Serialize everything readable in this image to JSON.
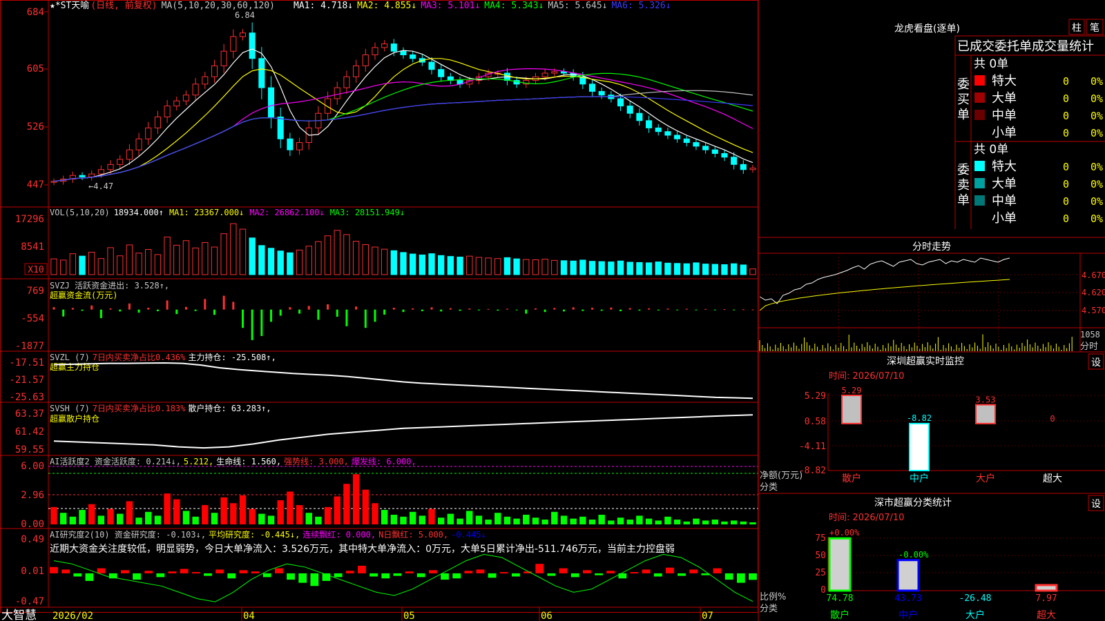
{
  "header": {
    "stock": "★*ST天喻",
    "mode": "(日线, 前复权)",
    "ma_title": "MA(5,10,20,30,60,120)",
    "ma_items": [
      {
        "label": "MA1: 4.718↓",
        "color": "#ffffff"
      },
      {
        "label": "MA2: 4.855↓",
        "color": "#ffff00"
      },
      {
        "label": "MA3: 5.101↓",
        "color": "#ff00ff"
      },
      {
        "label": "MA4: 5.343↓",
        "color": "#00ff00"
      },
      {
        "label": "MA5: 5.645↓",
        "color": "#c0c0c0"
      },
      {
        "label": "MA6: 5.326↓",
        "color": "#3a3aff"
      }
    ],
    "high_label": "6.84",
    "low_label": "←4.47"
  },
  "price_axis": [
    "684",
    "605",
    "526",
    "447"
  ],
  "volume_panel": {
    "title": "VOL(5,10,20)",
    "value": "18934.000↑",
    "ma1": "MA1: 23367.000↓",
    "ma2": "MA2: 26862.100↓",
    "ma3": "MA3: 28151.949↓",
    "axis": [
      "17296",
      "8541"
    ],
    "unit": "X10"
  },
  "svzj_panel": {
    "title": "SVZJ  活跃资金进出: 3.528↑,",
    "subtitle": "超赢资金流(万元)",
    "axis": [
      "769",
      "-554",
      "-1877"
    ]
  },
  "svzl_panel": {
    "title": "SVZL (7)",
    "red_text": "7日内买卖净占比0.436%",
    "hold": "主力持仓: -25.508↑,",
    "subtitle": "超赢主力持仓",
    "axis": [
      "-17.51",
      "-21.57",
      "-25.63"
    ]
  },
  "svsh_panel": {
    "title": "SVSH (7)",
    "red_text": "7日内买卖净占比0.183%",
    "hold": "散户持仓: 63.283↑,",
    "subtitle": "超赢散户持仓",
    "axis": [
      "63.37",
      "61.42",
      "59.55"
    ]
  },
  "ai_activity_panel": {
    "title": "AI活跃度2 资金活跃度: 0.214↓,",
    "v2": "5.212,",
    "life": "生命线: 1.560,",
    "strong": "强势线: 3.000,",
    "burst": "爆发线: 6.000,",
    "axis": [
      "6.00",
      "2.96",
      "0.00"
    ]
  },
  "ai_research_panel": {
    "title": "AI研究度2(10) 资金研究度: -0.103↓,",
    "avg": "平均研究度: -0.445↓,",
    "red_flag": "连续飘红: 0.000,",
    "n_flag": "N日飘红: 5.000,",
    "last": "-0.445↓",
    "comment": "近期大资金关注度较低，明显弱势，今日大单净流入：3.526万元，其中特大单净流入：0万元，大单5日累计净出-511.746万元，当前主力控盘弱",
    "axis": [
      "0.49",
      "0.01",
      "-0.47"
    ]
  },
  "footer": {
    "brand": "大智慧",
    "dates": [
      "2026/02",
      "04",
      "05",
      "06",
      "07"
    ]
  },
  "right_panel": {
    "title": "龙虎看盘(逐单)",
    "btn1": "柱",
    "btn2": "笔",
    "table_header": "已成交委托单成交量统计",
    "buy_label": "委买单",
    "sell_label": "委卖单",
    "buy_total": "共 0单",
    "sell_total": "共 0单",
    "buy_rows": [
      {
        "label": "特大",
        "color": "#ff0000",
        "v": "0",
        "p": "0%"
      },
      {
        "label": "大单",
        "color": "#a00000",
        "v": "0",
        "p": "0%"
      },
      {
        "label": "中单",
        "color": "#6a0000",
        "v": "0",
        "p": "0%"
      },
      {
        "label": "小单",
        "color": "none",
        "v": "0",
        "p": "0%"
      }
    ],
    "sell_rows": [
      {
        "label": "特大",
        "color": "#00ffff",
        "v": "0",
        "p": "0%"
      },
      {
        "label": "大单",
        "color": "#00a0a0",
        "v": "0",
        "p": "0%"
      },
      {
        "label": "中单",
        "color": "#007878",
        "v": "0",
        "p": "0%"
      },
      {
        "label": "小单",
        "color": "none",
        "v": "0",
        "p": "0%"
      }
    ],
    "intraday_title": "分时走势",
    "intraday_axis": [
      "4.670",
      "4.620",
      "4.570"
    ],
    "intraday_vol": "1058",
    "intraday_unit": "分时",
    "monitor_title": "深圳超赢实时监控",
    "monitor_time": "时间: 2026/07/10",
    "monitor_axis": [
      "5.29",
      "0.58",
      "-4.11",
      "-8.82"
    ],
    "monitor_ylabel": "净额(万元)",
    "monitor_xlabel": "分类",
    "monitor_set": "设",
    "monitor_bars": [
      {
        "cat": "散户",
        "value": "5.29"
      },
      {
        "cat": "中户",
        "value": "-8.82"
      },
      {
        "cat": "大户",
        "value": "3.53"
      },
      {
        "cat": "超大",
        "value": "0"
      }
    ],
    "stat_title": "深市超赢分类统计",
    "stat_time": "时间: 2026/07/10",
    "stat_axis": [
      "75",
      "50",
      "25",
      "0"
    ],
    "stat_ylabel": "比例%",
    "stat_xlabel": "分类",
    "stat_set": "设",
    "stat_top": [
      "+0.00%",
      "-0.00%"
    ],
    "stat_bars": [
      {
        "cat": "散户",
        "value": "74.78"
      },
      {
        "cat": "中户",
        "value": "43.73"
      },
      {
        "cat": "大户",
        "value": "-26.48"
      },
      {
        "cat": "超大",
        "value": "7.97"
      }
    ]
  },
  "chart_data": [
    {
      "type": "candlestick",
      "title": "★*ST天喻 (日线, 前复权)",
      "ylim": [
        4.47,
        6.84
      ],
      "annotations": {
        "high": 6.84,
        "low": 4.47
      },
      "series": [
        {
          "name": "close",
          "values": [
            4.52,
            4.55,
            4.6,
            4.58,
            4.62,
            4.68,
            4.75,
            4.82,
            4.95,
            5.1,
            5.25,
            5.4,
            5.55,
            5.62,
            5.7,
            5.85,
            5.95,
            6.1,
            6.3,
            6.5,
            6.55,
            6.2,
            5.8,
            5.4,
            5.1,
            4.95,
            5.05,
            5.25,
            5.45,
            5.65,
            5.8,
            5.95,
            6.1,
            6.25,
            6.35,
            6.4,
            6.3,
            6.25,
            6.2,
            6.15,
            6.05,
            5.95,
            5.9,
            5.85,
            5.9,
            5.95,
            6.0,
            6.0,
            5.9,
            5.85,
            5.9,
            5.95,
            6.0,
            6.02,
            6.0,
            5.95,
            5.85,
            5.75,
            5.7,
            5.65,
            5.55,
            5.45,
            5.35,
            5.25,
            5.2,
            5.15,
            5.1,
            5.05,
            5.0,
            4.95,
            4.9,
            4.85,
            4.75,
            4.68,
            4.7
          ]
        }
      ],
      "ma": {
        "MA1": 4.718,
        "MA2": 4.855,
        "MA3": 5.101,
        "MA4": 5.343,
        "MA5": 5.645,
        "MA6": 5.326
      }
    },
    {
      "type": "bar",
      "title": "VOL(5,10,20)",
      "ylim": [
        0,
        17296
      ],
      "series": [
        {
          "name": "VOL",
          "values": [
            5200,
            4800,
            6900,
            6100,
            7400,
            5300,
            8900,
            6200,
            9800,
            7100,
            8300,
            6600,
            12400,
            9700,
            11200,
            8800,
            10600,
            9100,
            13500,
            16800,
            15000,
            12100,
            9600,
            8700,
            7800,
            7200,
            8100,
            9400,
            10900,
            12800,
            14600,
            13200,
            11000,
            9900,
            9100,
            8400,
            7900,
            7300,
            6800,
            6500,
            6900,
            6300,
            6000,
            5800,
            6100,
            5700,
            5500,
            5300,
            5600,
            5200,
            5000,
            4900,
            5100,
            4700,
            4600,
            4500,
            4800,
            4400,
            4300,
            4200,
            4500,
            4100,
            4000,
            3900,
            4200,
            3800,
            3700,
            3600,
            3900,
            3500,
            3400,
            3300,
            3600,
            3200,
            1893
          ]
        }
      ]
    },
    {
      "type": "bar",
      "title": "超赢资金流(万元)",
      "ylim": [
        -1877,
        769
      ],
      "series": [
        {
          "name": "SVZJ",
          "values": [
            120,
            -340,
            80,
            -60,
            200,
            -420,
            60,
            -90,
            300,
            -150,
            90,
            -80,
            450,
            -220,
            130,
            -70,
            520,
            -260,
            680,
            380,
            -900,
            -1500,
            -1300,
            -600,
            -300,
            120,
            -200,
            180,
            -500,
            260,
            -350,
            -820,
            150,
            -900,
            -600,
            -250,
            90,
            -120,
            60,
            -80,
            110,
            -90,
            70,
            -60,
            50,
            -40,
            30,
            -50,
            40,
            -30,
            -200,
            60,
            -120,
            80,
            -90,
            110,
            -70,
            90,
            -60,
            100,
            -80,
            70,
            -50,
            60,
            -40,
            50,
            -30,
            40,
            -20,
            30,
            -25,
            20,
            -15,
            10,
            3.5
          ]
        }
      ]
    },
    {
      "type": "line",
      "title": "超赢主力持仓",
      "ylim": [
        -25.63,
        -17.51
      ],
      "series": [
        {
          "name": "主力持仓",
          "values": [
            -17.9,
            -17.8,
            -17.7,
            -17.6,
            -17.6,
            -17.55,
            -17.51,
            -17.6,
            -18.0,
            -18.6,
            -19.0,
            -19.3,
            -19.6,
            -19.9,
            -20.1,
            -20.3,
            -20.6,
            -21.0,
            -21.4,
            -21.8,
            -22.1,
            -22.3,
            -22.5,
            -22.7,
            -22.9,
            -23.1,
            -23.3,
            -23.5,
            -23.7,
            -23.9,
            -24.1,
            -24.3,
            -24.5,
            -24.7,
            -24.9,
            -25.1,
            -25.3,
            -25.4,
            -25.508
          ]
        }
      ]
    },
    {
      "type": "line",
      "title": "超赢散户持仓",
      "ylim": [
        59.55,
        63.37
      ],
      "series": [
        {
          "name": "散户持仓",
          "values": [
            60.6,
            60.5,
            60.4,
            60.3,
            60.2,
            60.0,
            59.9,
            60.0,
            60.3,
            60.7,
            61.0,
            61.3,
            61.5,
            61.7,
            61.9,
            62.0,
            62.1,
            62.2,
            62.3,
            62.4,
            62.5,
            62.6,
            62.7,
            62.8,
            62.9,
            63.0,
            63.1,
            63.2,
            63.283
          ]
        }
      ]
    },
    {
      "type": "bar",
      "title": "AI活跃度2",
      "ylim": [
        0,
        6.0
      ],
      "series": [
        {
          "name": "资金活跃度",
          "values": [
            1.8,
            1.2,
            0.8,
            1.5,
            2.1,
            0.9,
            1.6,
            1.1,
            2.4,
            0.7,
            1.3,
            0.9,
            3.2,
            2.6,
            1.4,
            0.8,
            2.0,
            1.2,
            2.8,
            2.2,
            3.0,
            1.6,
            1.1,
            0.9,
            2.5,
            3.4,
            2.0,
            1.2,
            0.8,
            1.8,
            2.9,
            4.2,
            5.2,
            3.6,
            2.2,
            1.5,
            1.0,
            0.8,
            1.3,
            0.9,
            1.6,
            0.7,
            1.1,
            0.6,
            1.4,
            0.9,
            0.5,
            1.2,
            0.8,
            0.6,
            1.0,
            0.7,
            0.5,
            1.3,
            0.9,
            0.6,
            0.8,
            0.5,
            1.0,
            0.4,
            0.7,
            0.5,
            0.9,
            0.6,
            0.4,
            0.8,
            0.5,
            0.3,
            0.6,
            0.4,
            0.5,
            0.3,
            0.4,
            0.3,
            0.214
          ]
        }
      ],
      "reference_lines": {
        "生命线": 1.56,
        "强势线": 3.0,
        "爆发线": 6.0
      }
    },
    {
      "type": "bar",
      "title": "AI研究度2(10)",
      "ylim": [
        -0.47,
        0.49
      ],
      "series": [
        {
          "name": "资金研究度",
          "values": [
            0.1,
            0.06,
            -0.05,
            -0.12,
            0.08,
            -0.08,
            0.05,
            -0.1,
            0.04,
            -0.06,
            0.03,
            0.07,
            0.02,
            -0.04,
            0.06,
            -0.08,
            0.05,
            0.03,
            -0.06,
            0.08,
            -0.1,
            -0.15,
            -0.2,
            -0.12,
            -0.06,
            0.04,
            0.12,
            -0.05,
            -0.08,
            -0.04,
            0.03,
            -0.06,
            0.05,
            -0.1,
            -0.08,
            0.04,
            0.06,
            -0.07,
            0.02,
            -0.05,
            0.03,
            0.15,
            -0.04,
            0.08,
            -0.06,
            0.05,
            -0.03,
            0.04,
            -0.08,
            0.02,
            0.06,
            -0.05,
            0.09,
            -0.04,
            0.06,
            -0.03,
            0.08,
            -0.1,
            -0.15,
            -0.103
          ]
        },
        {
          "name": "平均研究度",
          "values": [
            0.2,
            0.15,
            0.05,
            -0.05,
            -0.1,
            -0.15,
            -0.2,
            -0.3,
            -0.4,
            -0.45,
            -0.3,
            -0.1,
            0.05,
            0.15,
            0.1,
            0.0,
            -0.1,
            -0.2,
            -0.3,
            -0.35,
            -0.25,
            -0.1,
            0.05,
            0.2,
            0.3,
            0.25,
            0.1,
            -0.05,
            -0.2,
            -0.3,
            -0.25,
            -0.1,
            0.05,
            0.2,
            0.3,
            0.25,
            0.1,
            -0.1,
            -0.3,
            -0.445
          ]
        }
      ]
    }
  ]
}
